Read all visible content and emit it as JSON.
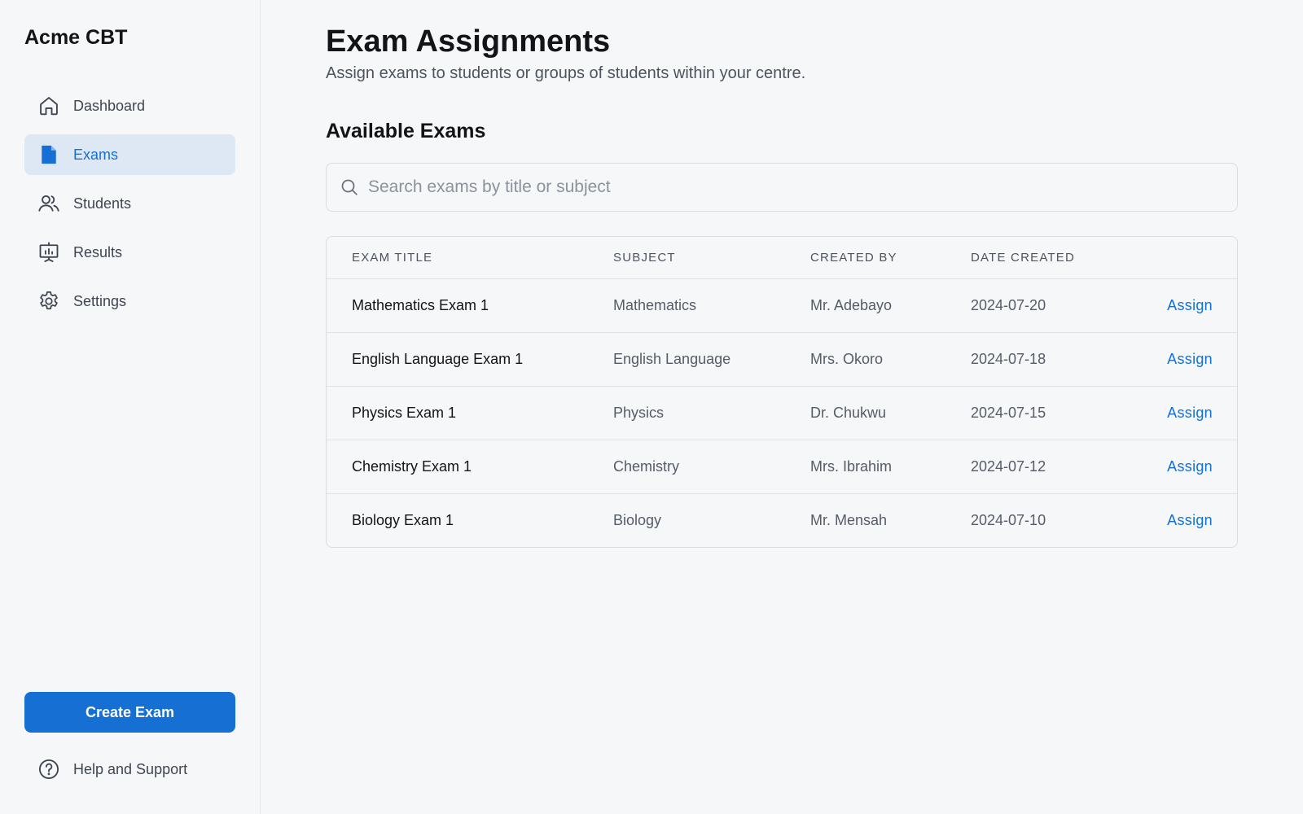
{
  "app": {
    "brand": "Acme CBT"
  },
  "sidebar": {
    "items": [
      {
        "label": "Dashboard",
        "icon": "home-icon",
        "active": false
      },
      {
        "label": "Exams",
        "icon": "document-icon",
        "active": true
      },
      {
        "label": "Students",
        "icon": "users-icon",
        "active": false
      },
      {
        "label": "Results",
        "icon": "presentation-chart-icon",
        "active": false
      },
      {
        "label": "Settings",
        "icon": "gear-icon",
        "active": false
      }
    ],
    "create_label": "Create Exam",
    "help_label": "Help and Support",
    "help_icon": "help-circle-icon"
  },
  "page": {
    "title": "Exam Assignments",
    "subtitle": "Assign exams to students or groups of students within your centre.",
    "section_title": "Available Exams"
  },
  "search": {
    "placeholder": "Search exams by title or subject",
    "value": "",
    "icon": "search-icon"
  },
  "table": {
    "columns": [
      "EXAM TITLE",
      "SUBJECT",
      "CREATED BY",
      "DATE CREATED"
    ],
    "rows": [
      {
        "title": "Mathematics Exam 1",
        "subject": "Mathematics",
        "created_by": "Mr. Adebayo",
        "date": "2024-07-20",
        "action": "Assign"
      },
      {
        "title": "English Language Exam 1",
        "subject": "English Language",
        "created_by": "Mrs. Okoro",
        "date": "2024-07-18",
        "action": "Assign"
      },
      {
        "title": "Physics Exam 1",
        "subject": "Physics",
        "created_by": "Dr. Chukwu",
        "date": "2024-07-15",
        "action": "Assign"
      },
      {
        "title": "Chemistry Exam 1",
        "subject": "Chemistry",
        "created_by": "Mrs. Ibrahim",
        "date": "2024-07-12",
        "action": "Assign"
      },
      {
        "title": "Biology Exam 1",
        "subject": "Biology",
        "created_by": "Mr. Mensah",
        "date": "2024-07-10",
        "action": "Assign"
      }
    ]
  },
  "colors": {
    "accent": "#1670d4",
    "active_bg": "#dde8f4",
    "background": "#f6f7f9"
  }
}
